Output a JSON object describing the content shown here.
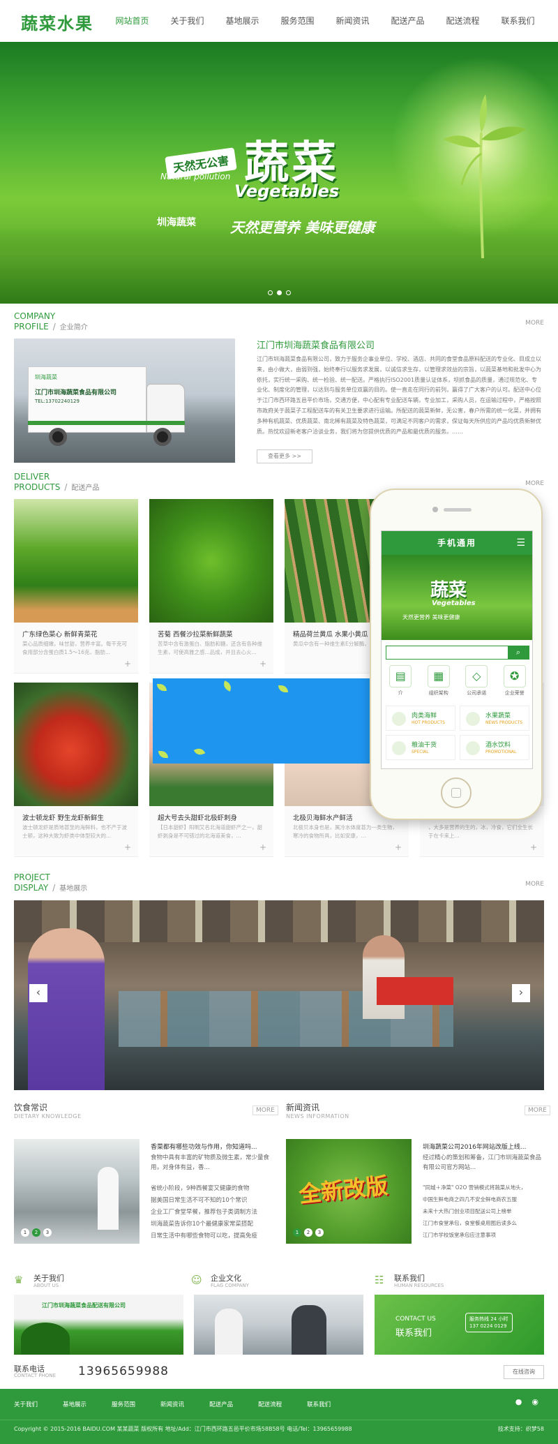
{
  "header": {
    "logo": "蔬菜水果",
    "nav": [
      "网站首页",
      "关于我们",
      "基地展示",
      "服务范围",
      "新闻资讯",
      "配送产品",
      "配送流程",
      "联系我们"
    ]
  },
  "banner": {
    "badge": "天然无公害",
    "badge_en": "Natural pollution",
    "title": "蔬菜",
    "title_en": "Vegetables",
    "brand": "圳海蔬菜",
    "slogan": "天然更营养 美味更健康"
  },
  "company": {
    "title_en1": "COMPANY",
    "title_en2": "PROFILE",
    "title_cn": "企业简介",
    "more": "MORE",
    "photo_logo": "圳海蔬菜",
    "truck_text": "江门市圳海蔬菜食品有限公司",
    "truck_tel": "TEL:13702240129",
    "name": "江门市圳海蔬菜食品有限公司",
    "text": "江门市圳海蔬菜食品有限公司，致力于服务企事业单位、学校、酒店、共同的食堂食品原料配送的专业化、目成立以来，由小做大，由弱到强，始终奉行以服务求发展，以诚信求生存，以管理求效益的宗旨，以蔬菜基地和批发中心为依托，实行统一采购、统一检验、统一配送。严格执行ISO2001质量认证体系，坝抓食品的质量，通过规范化、专业化、制度化的管理，以达到与服务单位双赢的目的。使一直走在同行的前列，赢得了广大客户的认可。配送中心位于江门市西环路五邑平价市场，交通方便，中心配有专业配送车辆，专业加工，采购人员，在运输过程中，严格按照市政府关于蔬菜子工程配送车的有关卫生要求进行运输。所配送的蔬菜新鲜，无公害，春户所需的统一化菜，并拥有多种有机蔬菜、优质蔬菜、南北稀有蔬菜及特色蔬菜，可满足不同客户的需求，保证每天所供应的产品均优质新鲜优质。热忱欢迎新老客户洽谈业务，我们将为您提供优质的产品和最优质的服务。……",
    "button": "查看更多 >>"
  },
  "products": {
    "title_en1": "DELIVER",
    "title_en2": "PRODUCTS",
    "title_cn": "配送产品",
    "more": "MORE",
    "items": [
      {
        "name": "广东绿色菜心 新鲜青菜花",
        "desc": "菜心品质细嫩，味甘甜，营养丰富。每干克可食用部分含蛋白质1.5～16克、脂肪..."
      },
      {
        "name": "苦菊 西餐沙拉菜新鲜蔬菜",
        "desc": "苦草中含有激蛋白、脂肪和糖，还含有各种维生素，可使高雅之感...品成，并且去心火..."
      },
      {
        "name": "精品荷兰黄瓜 水果小黄瓜",
        "desc": "黄瓜中含有一种维生素E分解酶，可以延..."
      },
      {
        "name": "",
        "desc": ""
      },
      {
        "name": "波士顿龙虾 野生龙虾新鲜生",
        "desc": "波士顿龙虾是质地甚至的海鲜料，也不产于波士顿，这种大致为虾类中体型较大的..."
      },
      {
        "name": "超大号去头甜虾北极虾刺身",
        "desc": "【日本甜虾】阳明又名北海道甜虾产之一，甜虾剥身是不可错过的北海道美食，..."
      },
      {
        "name": "北极贝海鲜水产鲜活",
        "desc": "北极贝本身也是，属冷水体度甚为一类生物，寒冷的食物所具，比如安康，..."
      },
      {
        "name": "",
        "desc": "，大多是营养的生的，冰，冷食，它们全生长于在卡来上..."
      }
    ]
  },
  "phone": {
    "header": "手机通用",
    "menu_icon": "menu-icon",
    "banner_title": "蔬菜",
    "banner_en": "Vegetables",
    "banner_slogan": "天然更营养 美味更健康",
    "search_icon": "search-icon",
    "icons": [
      "介",
      "组织架构",
      "公司承诺",
      "企业荣誉"
    ],
    "cats": [
      {
        "cn": "肉类海鲜",
        "en": "HOT PRODUCTS"
      },
      {
        "cn": "水果蔬菜",
        "en": "NEWS PRODUCTS"
      },
      {
        "cn": "粮油干货",
        "en": "SPECIAL"
      },
      {
        "cn": "酒水饮料",
        "en": "PROMOTIONAL"
      }
    ]
  },
  "project": {
    "title_en1": "PROJECT",
    "title_en2": "DISPLAY",
    "title_cn": "基地展示",
    "more": "MORE",
    "prev": "‹",
    "next": "›"
  },
  "news": {
    "left": {
      "title": "饮食常识",
      "title_en": "DIETARY KNOWLEDGE",
      "more": "MORE",
      "lines": [
        "香菜都有哪些功效与作用，你知道吗...",
        "食物中具有丰富的矿物质及微生素，常少量食",
        "用，对身体有益，香...",
        "",
        "省统小阶段，9种西餐宴又健康的食物",
        "据美国日常生活不可不知的10个常识",
        "企业工厂食堂早餐，推荐包子类调制方法",
        "圳海蔬菜告诉你10个最健康家常菜搭配",
        "日常生活中有哪些食物可以吃，提高免疫"
      ]
    },
    "right": {
      "title": "新闻资讯",
      "title_en": "NEWS INFORMATION",
      "more": "MORE",
      "badge": "全新改版",
      "lines": [
        "圳海蔬菜公司2016年网站改版上线...",
        "经过精心的策划和筹备，江门市圳海蔬菜食品",
        "有限公司官方网站...",
        "",
        "\"同城＋净菜\" O2O 营销模式将蔬菜从地头，",
        "中国生鲜电商之四几不安全鲜电商农五服",
        "未来十大热门创业项目配送公司上榜单",
        "江门市食堂承包，食堂餐桌用图后读多么",
        "江门市学校饭堂承包应注意事项"
      ]
    },
    "pager": [
      "1",
      "2",
      "3"
    ]
  },
  "aboutrow": {
    "items": [
      {
        "cn": "关于我们",
        "en": "ABOUT US",
        "icon": "trophy-icon"
      },
      {
        "cn": "企业文化",
        "en": "FLAG COMPANY",
        "icon": "person-icon"
      },
      {
        "cn": "联系我们",
        "en": "HUMAN RESOURCES",
        "icon": "handshake-icon"
      }
    ],
    "sign": "江门市圳海蔬菜食品配送有限公司",
    "contact_en": "CONTACT US",
    "contact_cn": "联系我们",
    "contact_tag": "服务热线 24 小时 137 0224 0129",
    "phone_label": "联系电话",
    "phone_label_en": "CONTACT PHONE",
    "phone": "13965659988",
    "consult": "在线咨询"
  },
  "footer": {
    "nav": [
      "关于我们",
      "基地展示",
      "服务范围",
      "新闻资讯",
      "配送产品",
      "配送流程",
      "联系我们"
    ],
    "copyright": "Copyright © 2015-2016 BAIDU.COM 某某蔬菜 版权所有    地址/Add：江门市西环路五邑平价市场58B58号    电话/Tel：13965659988",
    "tech": "技术支持：织梦58",
    "qq_icon": "qq-icon",
    "wechat_icon": "wechat-icon"
  },
  "colors": {
    "accent": "#2f9a3c",
    "overlay_blue": "#1e96f0"
  }
}
